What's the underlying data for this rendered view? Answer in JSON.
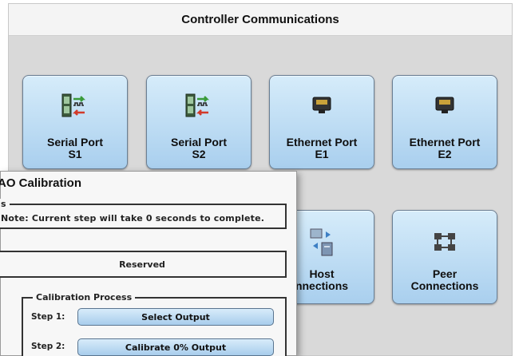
{
  "main": {
    "title": "Controller Communications",
    "tiles": [
      {
        "line1": "Serial Port",
        "line2": "S1",
        "icon": "serial-port-icon"
      },
      {
        "line1": "Serial Port",
        "line2": "S2",
        "icon": "serial-port-icon"
      },
      {
        "line1": "Ethernet Port",
        "line2": "E1",
        "icon": "ethernet-port-icon"
      },
      {
        "line1": "Ethernet Port",
        "line2": "E2",
        "icon": "ethernet-port-icon"
      },
      {
        "line1": "Host",
        "line2": "nnections",
        "icon": "host-connections-icon"
      },
      {
        "line1": "Peer",
        "line2": "Connections",
        "icon": "peer-connections-icon"
      }
    ]
  },
  "dialog": {
    "title": "AO Calibration",
    "status_legend": "s",
    "status_note": "Note: Current step will take  0  seconds to complete.",
    "reserved_label": "Reserved",
    "process_legend": "Calibration Process",
    "steps": [
      {
        "label": "Step 1:",
        "button": "Select Output"
      },
      {
        "label": "Step 2:",
        "button": "Calibrate 0% Output"
      }
    ]
  },
  "colors": {
    "tile_top": "#d6ecfa",
    "tile_bottom": "#a9cfee",
    "background": "#d9d9d9"
  }
}
